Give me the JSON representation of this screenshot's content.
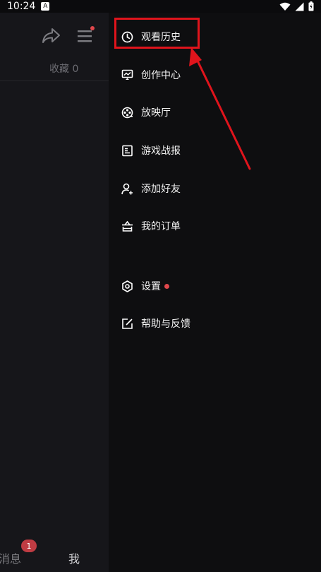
{
  "status_bar": {
    "time": "10:24",
    "notification_icon": "a-notification-icon",
    "wifi_icon": "wifi-icon",
    "signal_icon": "signal-icon",
    "battery_icon": "battery-icon"
  },
  "left_pane": {
    "share_icon": "share-icon",
    "menu_icon": "menu-icon",
    "favorites_label": "收藏 0",
    "bottom_nav": {
      "messages_label": "消息",
      "messages_badge": "1",
      "me_label": "我"
    }
  },
  "drawer": {
    "items": [
      {
        "label": "观看历史",
        "icon": "clock-icon"
      },
      {
        "label": "创作中心",
        "icon": "creator-monitor-icon"
      },
      {
        "label": "放映厅",
        "icon": "film-reel-icon"
      },
      {
        "label": "游戏战报",
        "icon": "document-icon"
      },
      {
        "label": "添加好友",
        "icon": "add-user-icon"
      },
      {
        "label": "我的订单",
        "icon": "basket-icon"
      },
      {
        "label": "设置",
        "icon": "settings-hex-icon"
      },
      {
        "label": "帮助与反馈",
        "icon": "edit-feedback-icon"
      }
    ]
  },
  "colors": {
    "background": "#0b0b0d",
    "left_pane": "#16161a",
    "drawer": "#0e0e10",
    "accent_red": "#e0141c",
    "badge_red": "#c03c43",
    "text_white": "#f3f3f3",
    "text_muted": "#6c6c72"
  }
}
